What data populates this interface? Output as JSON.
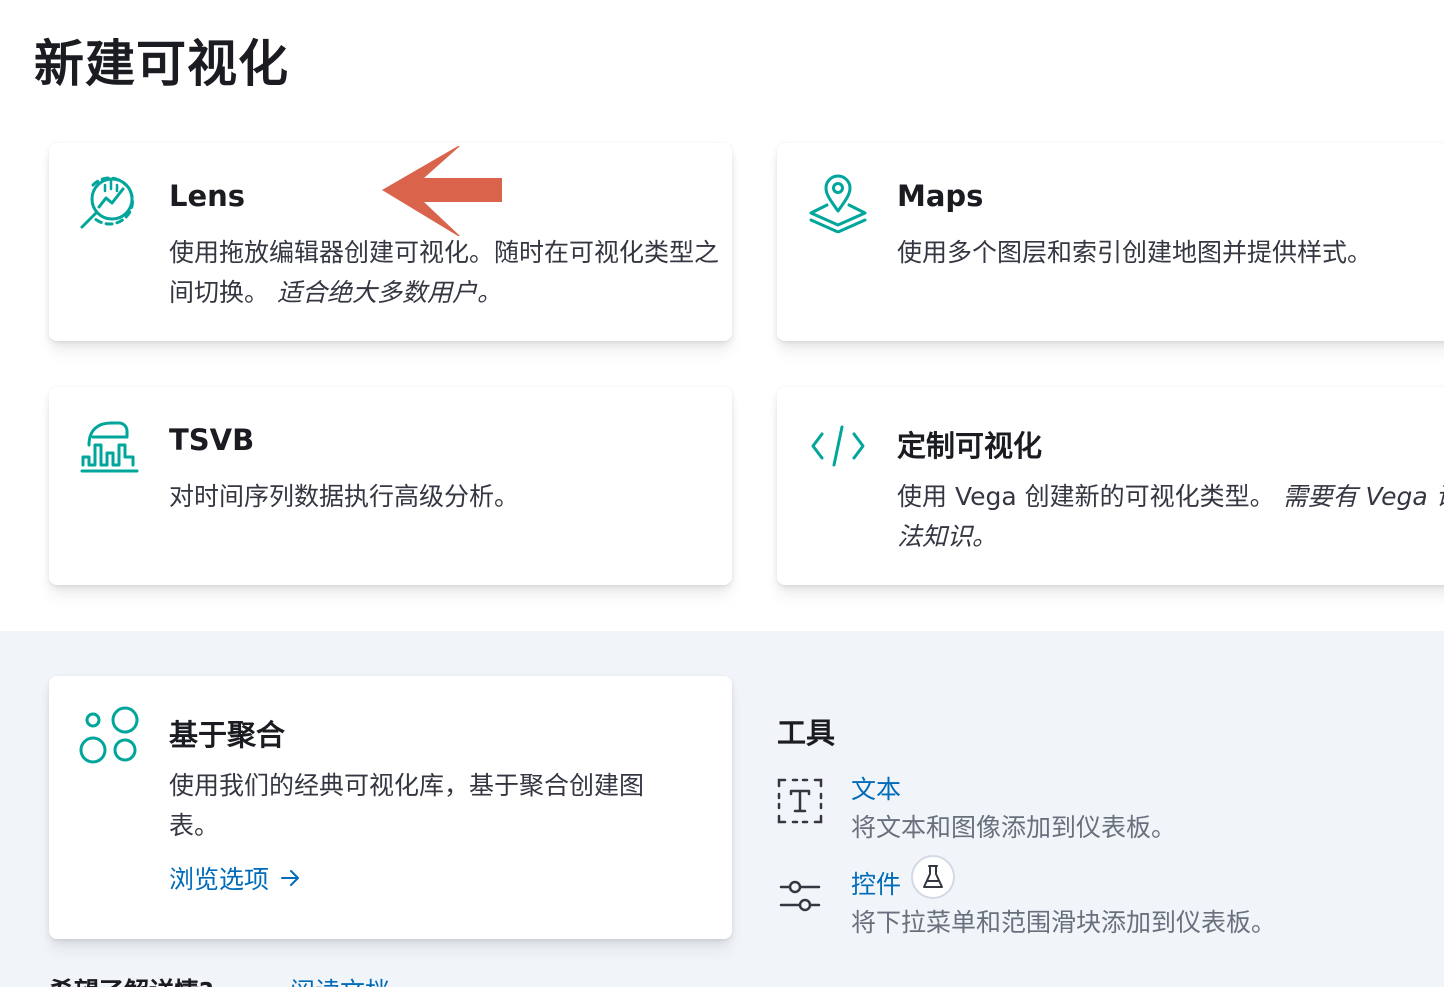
{
  "page": {
    "title": "新建可视化"
  },
  "cards": {
    "lens": {
      "title": "Lens",
      "desc": "使用拖放编辑器创建可视化。随时在可视化类型之间切换。",
      "desc_em": "适合绝大多数用户。",
      "icon": "lens-app-icon"
    },
    "maps": {
      "title": "Maps",
      "desc": "使用多个图层和索引创建地图并提供样式。",
      "icon": "maps-app-icon"
    },
    "tsvb": {
      "title": "TSVB",
      "desc": "对时间序列数据执行高级分析。",
      "icon": "tsvb-app-icon"
    },
    "vega": {
      "title": "定制可视化",
      "desc": "使用 Vega 创建新的可视化类型。",
      "desc_em": "需要有 Vega 语法知识。",
      "icon": "code-icon"
    },
    "aggregation": {
      "title": "基于聚合",
      "desc": "使用我们的经典可视化库，基于聚合创建图表。",
      "link": "浏览选项",
      "icon": "aggregation-icon"
    }
  },
  "tools": {
    "title": "工具",
    "items": [
      {
        "title": "文本",
        "desc": "将文本和图像添加到仪表板。",
        "icon": "text-tool-icon"
      },
      {
        "title": "控件",
        "desc": "将下拉菜单和范围滑块添加到仪表板。",
        "icon": "controls-icon",
        "badge": "beaker-icon"
      }
    ]
  },
  "footer": {
    "text": "希望了解详情?",
    "link": "阅读文档"
  },
  "colors": {
    "accent": "#00a69b",
    "link": "#006bb8",
    "annotation": "#d9634b"
  }
}
